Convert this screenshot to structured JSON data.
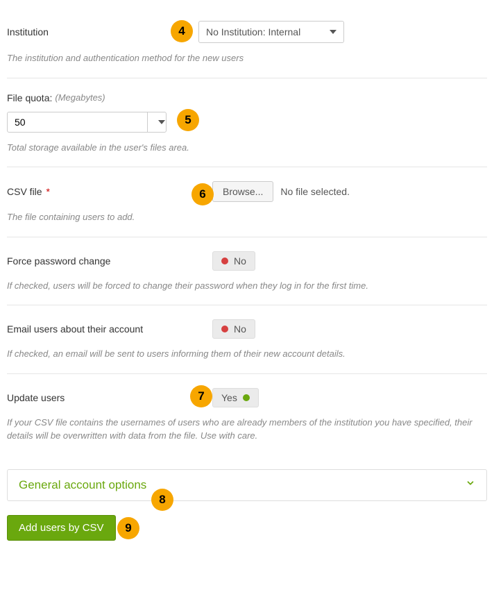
{
  "institution": {
    "label": "Institution",
    "selected": "No Institution: Internal",
    "help": "The institution and authentication method for the new users"
  },
  "file_quota": {
    "label": "File quota:",
    "suffix": "(Megabytes)",
    "value": "50",
    "help": "Total storage available in the user's files area."
  },
  "csv_file": {
    "label": "CSV file",
    "browse": "Browse...",
    "status": "No file selected.",
    "help": "The file containing users to add."
  },
  "force_password": {
    "label": "Force password change",
    "value": "No",
    "help": "If checked, users will be forced to change their password when they log in for the first time."
  },
  "email_users": {
    "label": "Email users about their account",
    "value": "No",
    "help": "If checked, an email will be sent to users informing them of their new account details."
  },
  "update_users": {
    "label": "Update users",
    "value": "Yes",
    "help": "If your CSV file contains the usernames of users who are already members of the institution you have specified, their details will be overwritten with data from the file. Use with care."
  },
  "accordion": {
    "title": "General account options"
  },
  "submit": {
    "label": "Add users by CSV"
  },
  "badges": {
    "b4": "4",
    "b5": "5",
    "b6": "6",
    "b7": "7",
    "b8": "8",
    "b9": "9"
  }
}
